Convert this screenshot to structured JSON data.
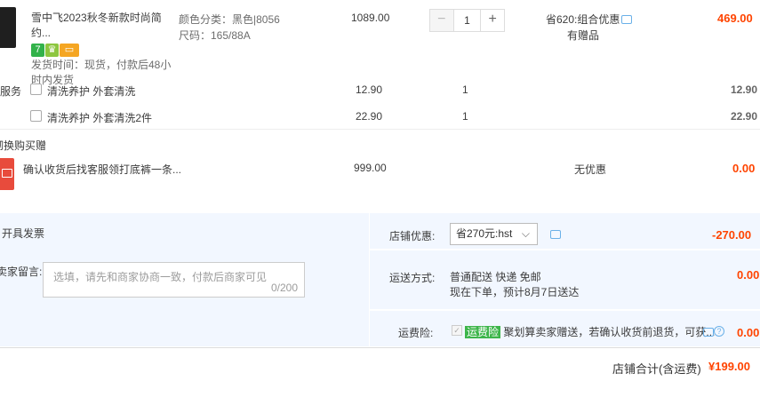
{
  "item": {
    "title": "雪中飞2023秋冬新款时尚简约...",
    "badges": [
      {
        "text": "7",
        "color": "#32b24a"
      },
      {
        "text": "",
        "color": "#8dc63f"
      },
      {
        "text": "",
        "color": "#f5a623"
      }
    ],
    "ship_info": "发货时间：现货，付款后48小时内发货",
    "sku_color": "颜色分类：黑色|8056",
    "sku_size": "尺码：165/88A",
    "unit_price": "1089.00",
    "quantity": "1",
    "discount": "省620:组合优惠",
    "gift": "有赠品",
    "total": "469.00"
  },
  "services_label": "服务",
  "services": [
    {
      "label": "清洗养护 外套清洗",
      "price": "12.90",
      "qty": "1",
      "total": "12.90"
    },
    {
      "label": "清洗养护 外套清洗2件",
      "price": "22.90",
      "qty": "1",
      "total": "22.90"
    }
  ],
  "gift_section": {
    "label": "砌换购买赠",
    "title": "确认收货后找客服领打底裤一条...",
    "price": "999.00",
    "discount": "无优惠",
    "total": "0.00"
  },
  "invoice": {
    "label": "开具发票"
  },
  "message": {
    "label": "卖家留言:",
    "placeholder": "选填，请先和商家协商一致，付款后商家可见",
    "counter": "0/200"
  },
  "shop_discount": {
    "label": "店铺优惠:",
    "selected": "省270元:hst",
    "amount": "-270.00"
  },
  "shipping": {
    "label": "运送方式:",
    "method": "普通配送 快递 免邮",
    "eta": "现在下单，预计8月7日送达",
    "amount": "0.00"
  },
  "insurance": {
    "label": "运费险:",
    "tag": "运费险",
    "text": "聚划算卖家赠送，若确认收货前退货，可获...",
    "amount": "0.00"
  },
  "footer": {
    "label": "店铺合计(含运费)",
    "total": "¥199.00"
  },
  "colors": {
    "accent": "#ff4400",
    "panel": "#f2f7ff"
  }
}
